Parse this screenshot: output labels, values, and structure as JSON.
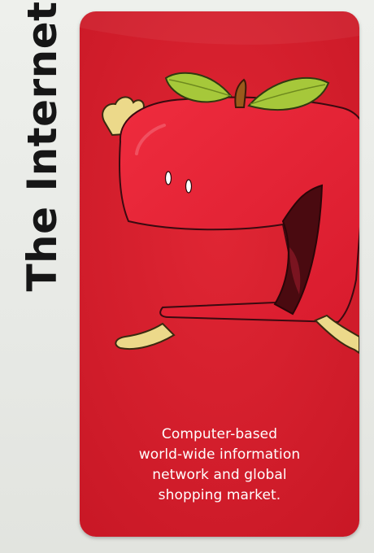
{
  "title": "The Internet",
  "caption_lines": [
    "Computer-based",
    "world-wide information",
    "network and global",
    "shopping market."
  ],
  "colors": {
    "card": "#d8202c",
    "apple": "#e62536",
    "leaf": "#a6c83a",
    "stem": "#9a5a1c",
    "hand": "#ecd98a",
    "mouth": "#4a0a10"
  },
  "illustration": {
    "subject": "cartoon apple character with open mouth",
    "icons": [
      "apple-icon",
      "leaf-icon",
      "stem-icon",
      "hand-icon"
    ]
  }
}
